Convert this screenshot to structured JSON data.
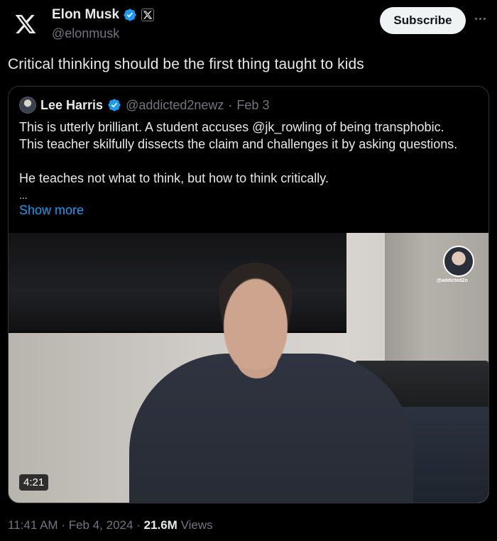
{
  "author": {
    "name": "Elon Musk",
    "handle": "@elonmusk"
  },
  "actions": {
    "subscribe_label": "Subscribe"
  },
  "tweet": {
    "text": "Critical thinking should be the first thing taught to kids",
    "time": "11:41 AM",
    "date": "Feb 4, 2024",
    "views_count": "21.6M",
    "views_label": "Views"
  },
  "quote": {
    "name": "Lee Harris",
    "handle": "@addicted2newz",
    "date": "Feb 3",
    "line1": "This is utterly brilliant. A student accuses @jk_rowling of being transphobic.",
    "line2": "This teacher skilfully dissects the claim and challenges it by asking questions.",
    "line3": "He teaches not what to think, but how to think critically.",
    "ellipsis": "...",
    "show_more": "Show more",
    "video_duration": "4:21",
    "video_watermark": "@addicted2n"
  },
  "icons": {
    "logo": "x-logo-icon",
    "verified": "verified-badge-icon",
    "affiliation": "x-affiliation-badge-icon",
    "more": "more-dots-icon"
  },
  "colors": {
    "background": "#000000",
    "text": "#e7e9ea",
    "secondary": "#71767b",
    "link": "#1d9bf0",
    "verified": "#1d9bf0",
    "border": "#2f3336"
  }
}
